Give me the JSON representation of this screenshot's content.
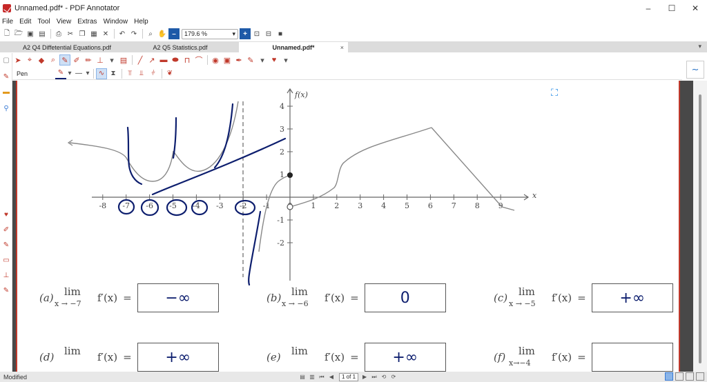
{
  "window": {
    "title": "Unnamed.pdf* - PDF Annotator",
    "controls": {
      "minimize": "–",
      "maximize": "☐",
      "close": "✕"
    }
  },
  "menu": [
    "File",
    "Edit",
    "Tool",
    "View",
    "Extras",
    "Window",
    "Help"
  ],
  "toolbar": {
    "zoom_value": "179.6 %",
    "zoom_minus": "–",
    "zoom_plus": "+"
  },
  "tabs": [
    {
      "label": "A2 Q4 Diffetential Equations.pdf",
      "active": false
    },
    {
      "label": "A2 Q5 Statistics.pdf",
      "active": false
    },
    {
      "label": "Unnamed.pdf*",
      "active": true
    }
  ],
  "tab_close": "×",
  "tab_menu": "▾",
  "pen_bar": {
    "label": "Pen"
  },
  "colors": {
    "ink": "#0d1e6e",
    "accent_red": "#c0392b",
    "graph": "#888888"
  },
  "graph": {
    "y_axis_label": "f(x)",
    "x_axis_label": "x",
    "x_ticks": [
      "-8",
      "-7",
      "-6",
      "-5",
      "-4",
      "-3",
      "-2",
      "-1",
      "0",
      "1",
      "2",
      "3",
      "4",
      "5",
      "6",
      "7",
      "8",
      "9"
    ],
    "y_ticks": [
      "4",
      "3",
      "2",
      "1",
      "-1",
      "-2"
    ]
  },
  "limits": [
    {
      "part": "(a)",
      "lim": "lim",
      "approach": "x → −7",
      "expr": "f′(x)",
      "eq": "=",
      "answer": "−∞"
    },
    {
      "part": "(b)",
      "lim": "lim",
      "approach": "x → −6",
      "expr": "f′(x)",
      "eq": "=",
      "answer": "0"
    },
    {
      "part": "(c)",
      "lim": "lim",
      "approach": "x → −5",
      "expr": "f′(x)",
      "eq": "=",
      "answer": "+∞"
    },
    {
      "part": "(d)",
      "lim": "lim",
      "approach": "",
      "expr": "f′(x)",
      "eq": "=",
      "answer": "+∞"
    },
    {
      "part": "(e)",
      "lim": "lim",
      "approach": "",
      "expr": "f′(x)",
      "eq": "=",
      "answer": "+∞"
    },
    {
      "part": "(f)",
      "lim": "lim",
      "approach": "x→−4",
      "expr": "f′(x)",
      "eq": "=",
      "answer": ""
    }
  ],
  "status": {
    "state": "Modified",
    "page_indicator": "1 of 1"
  }
}
